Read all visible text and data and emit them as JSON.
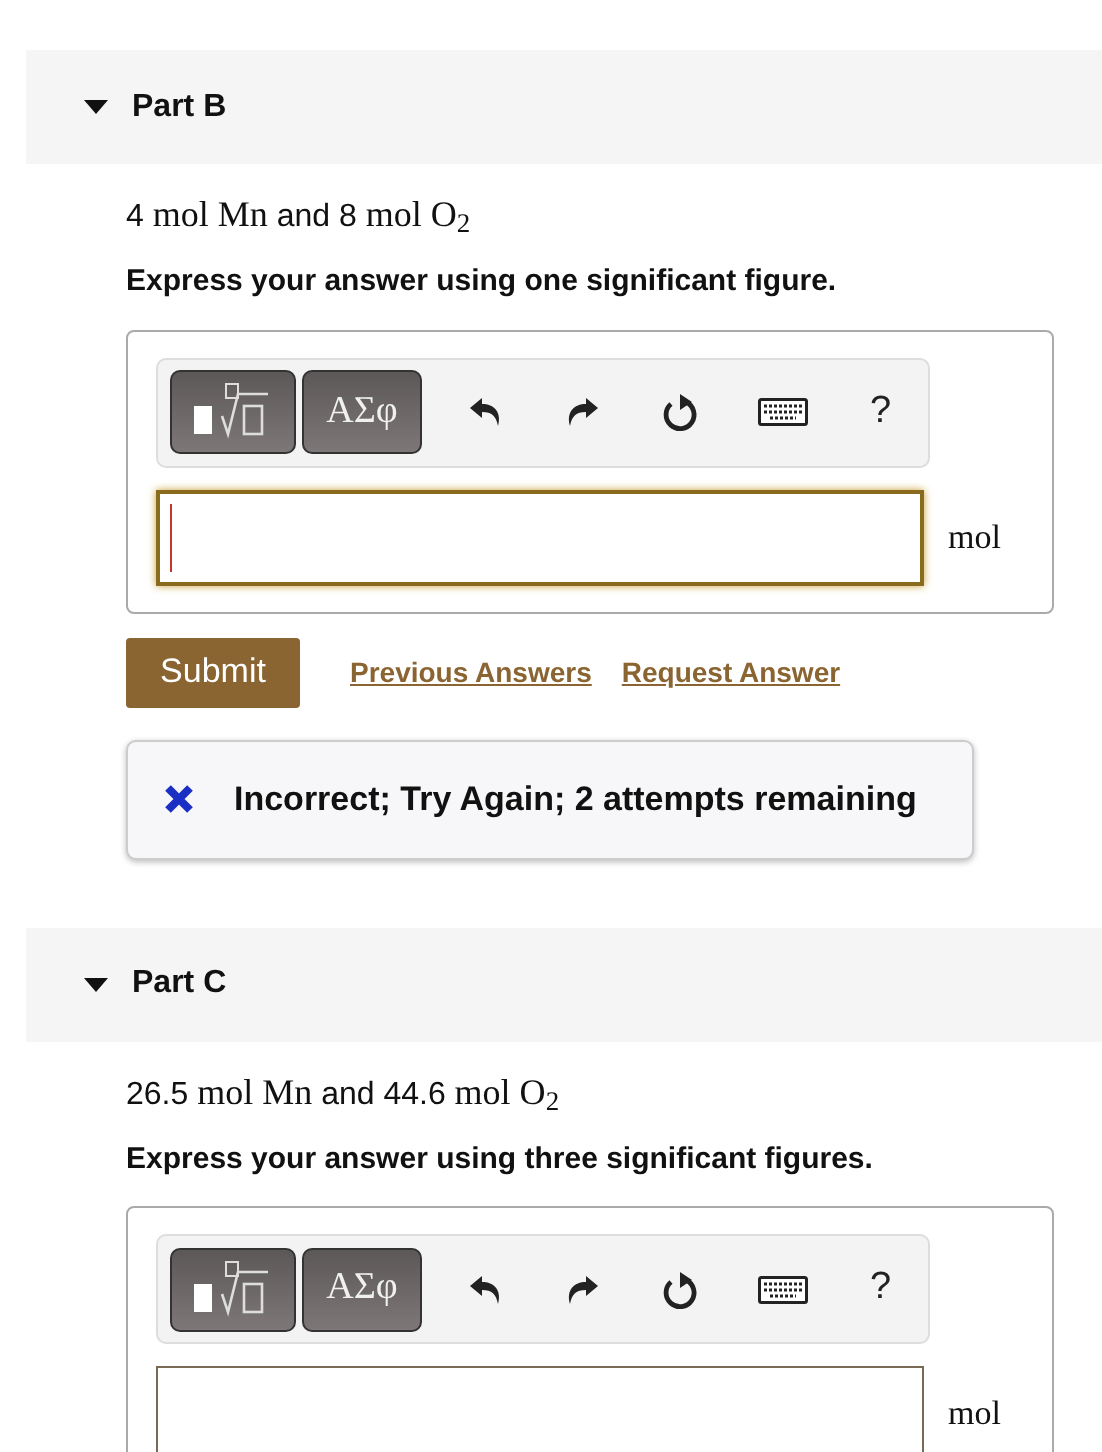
{
  "parts": [
    {
      "title": "Part B",
      "expanded": true,
      "problem": [
        {
          "kind": "sans",
          "text": "4"
        },
        {
          "kind": "math",
          "text": "mol Mn"
        },
        {
          "kind": "sans",
          "text": "and 8"
        },
        {
          "kind": "math",
          "text": "mol O$_{2}$"
        }
      ],
      "instruction": "Express your answer using one significant figure.",
      "toolbar": {
        "symbols_button": "ΑΣφ",
        "help": "?"
      },
      "answer": {
        "focused": true,
        "unit": "mol"
      },
      "submit": "Submit",
      "links": [
        "Previous Answers",
        "Request Answer"
      ],
      "feedback": {
        "kind": "incorrect",
        "text": "Incorrect; Try Again; 2 attempts remaining"
      }
    },
    {
      "title": "Part C",
      "expanded": true,
      "problem": [
        {
          "kind": "sans",
          "text": "26.5"
        },
        {
          "kind": "math",
          "text": "mol Mn"
        },
        {
          "kind": "sans",
          "text": "and 44.6"
        },
        {
          "kind": "math",
          "text": "mol O$_{2}$"
        }
      ],
      "instruction": "Express your answer using three significant figures.",
      "toolbar": {
        "symbols_button": "ΑΣφ",
        "help": "?"
      },
      "answer": {
        "focused": false,
        "unit": "mol"
      }
    }
  ]
}
